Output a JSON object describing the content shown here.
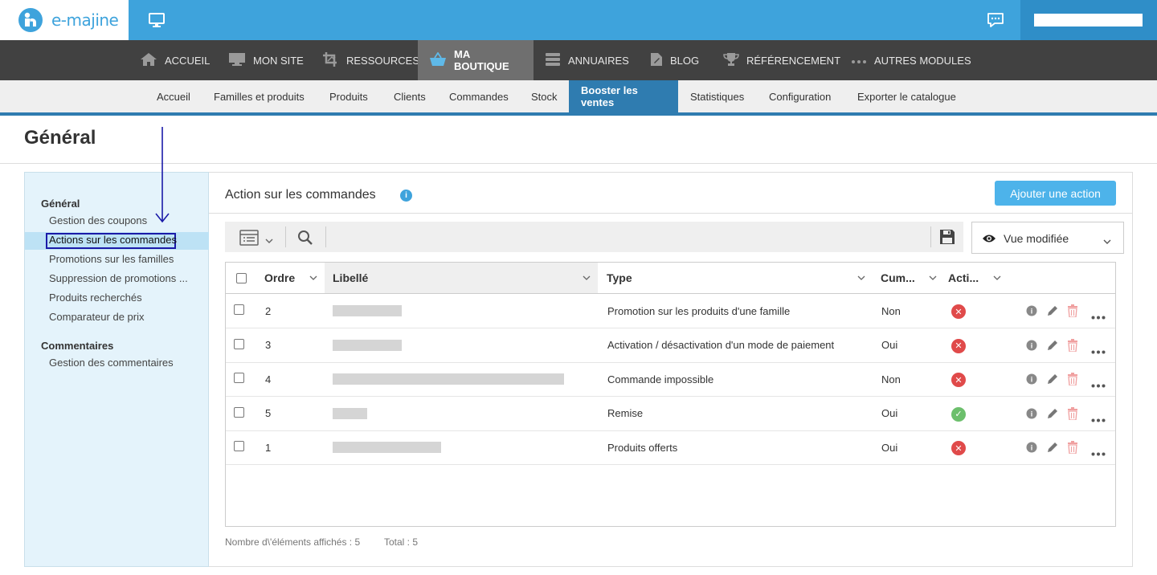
{
  "brand": {
    "logo_text": "e-majine",
    "accent": "#3ea3dc",
    "dark_nav": "#414141",
    "active_tab": "#2f7cb0"
  },
  "topbar": {
    "monitor_icon": "monitor-icon",
    "chat_icon": "chat-icon",
    "user_field_value": ""
  },
  "main_nav": [
    {
      "label": "ACCUEIL",
      "icon": "home-icon"
    },
    {
      "label": "MON SITE",
      "icon": "monitor-icon"
    },
    {
      "label": "RESSOURCES",
      "icon": "crop-icon"
    },
    {
      "label": "MA BOUTIQUE",
      "icon": "basket-icon",
      "active": true
    },
    {
      "label": "ANNUAIRES",
      "icon": "stack-icon"
    },
    {
      "label": "BLOG",
      "icon": "document-icon"
    },
    {
      "label": "RÉFÉRENCEMENT",
      "icon": "trophy-icon"
    },
    {
      "label": "AUTRES MODULES",
      "icon": "dots-icon"
    }
  ],
  "sub_nav": [
    {
      "label": "Accueil"
    },
    {
      "label": "Familles et produits"
    },
    {
      "label": "Produits"
    },
    {
      "label": "Clients"
    },
    {
      "label": "Commandes"
    },
    {
      "label": "Stock"
    },
    {
      "label": "Booster les ventes",
      "active": true
    },
    {
      "label": "Statistiques"
    },
    {
      "label": "Configuration"
    },
    {
      "label": "Exporter le catalogue"
    }
  ],
  "page": {
    "title": "Général"
  },
  "sidebar": {
    "groups": [
      {
        "title": "Général",
        "items": [
          {
            "label": "Gestion des coupons"
          },
          {
            "label": "Actions sur les commandes",
            "active": true
          },
          {
            "label": "Promotions sur les familles"
          },
          {
            "label": "Suppression de promotions ..."
          },
          {
            "label": "Produits recherchés"
          },
          {
            "label": "Comparateur de prix"
          }
        ]
      },
      {
        "title": "Commentaires",
        "items": [
          {
            "label": "Gestion des commentaires"
          }
        ]
      }
    ]
  },
  "content": {
    "title": "Action sur les commandes",
    "info_badge": "i",
    "add_button": "Ajouter une action",
    "view_select": "Vue modifiée",
    "columns": [
      "Ordre",
      "Libellé",
      "Type",
      "Cum...",
      "Acti..."
    ],
    "rows": [
      {
        "ordre": "2",
        "libelle_mask": 0.3,
        "type": "Promotion sur les produits d'une famille",
        "cum": "Non",
        "active": false
      },
      {
        "ordre": "3",
        "libelle_mask": 0.3,
        "type": "Activation / désactivation d'un mode de paiement",
        "cum": "Oui",
        "active": false
      },
      {
        "ordre": "4",
        "libelle_mask": 1.0,
        "type": "Commande impossible",
        "cum": "Non",
        "active": false
      },
      {
        "ordre": "5",
        "libelle_mask": 0.15,
        "type": "Remise",
        "cum": "Oui",
        "active": true
      },
      {
        "ordre": "1",
        "libelle_mask": 0.47,
        "type": "Produits offerts",
        "cum": "Oui",
        "active": false
      }
    ],
    "footer_count": "Nombre d\\'éléments affichés : 5",
    "footer_total": "Total : 5"
  }
}
